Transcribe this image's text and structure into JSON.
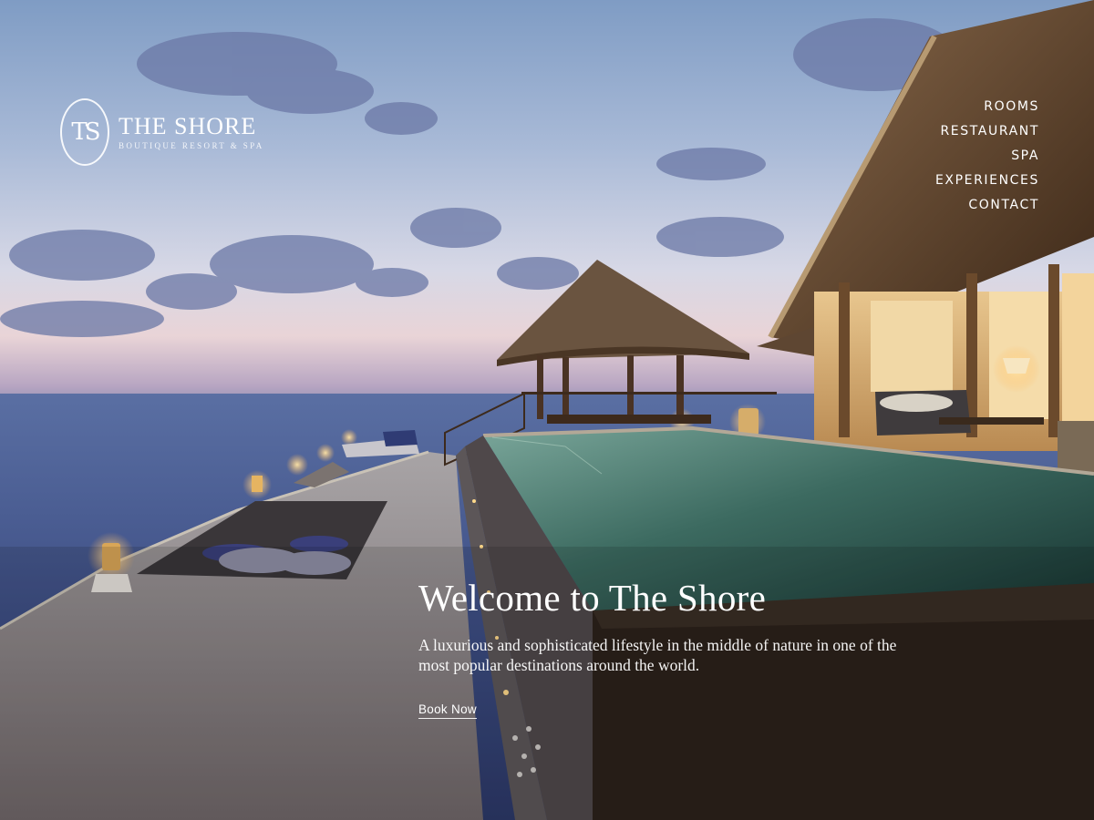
{
  "brand": {
    "monogram": "TS",
    "name": "THE SHORE",
    "tagline": "BOUTIQUE RESORT & SPA"
  },
  "nav": {
    "items": [
      {
        "label": "ROOMS"
      },
      {
        "label": "RESTAURANT"
      },
      {
        "label": "SPA"
      },
      {
        "label": "EXPERIENCES"
      },
      {
        "label": "CONTACT"
      }
    ]
  },
  "hero": {
    "title": "Welcome to The Shore",
    "description": "A luxurious and sophisticated lifestyle in the middle of nature in one of the most popular destinations around the world.",
    "cta_label": "Book Now"
  },
  "colors": {
    "text": "#ffffff",
    "pool": "#3f6c62",
    "wood": "#5a3a22"
  }
}
